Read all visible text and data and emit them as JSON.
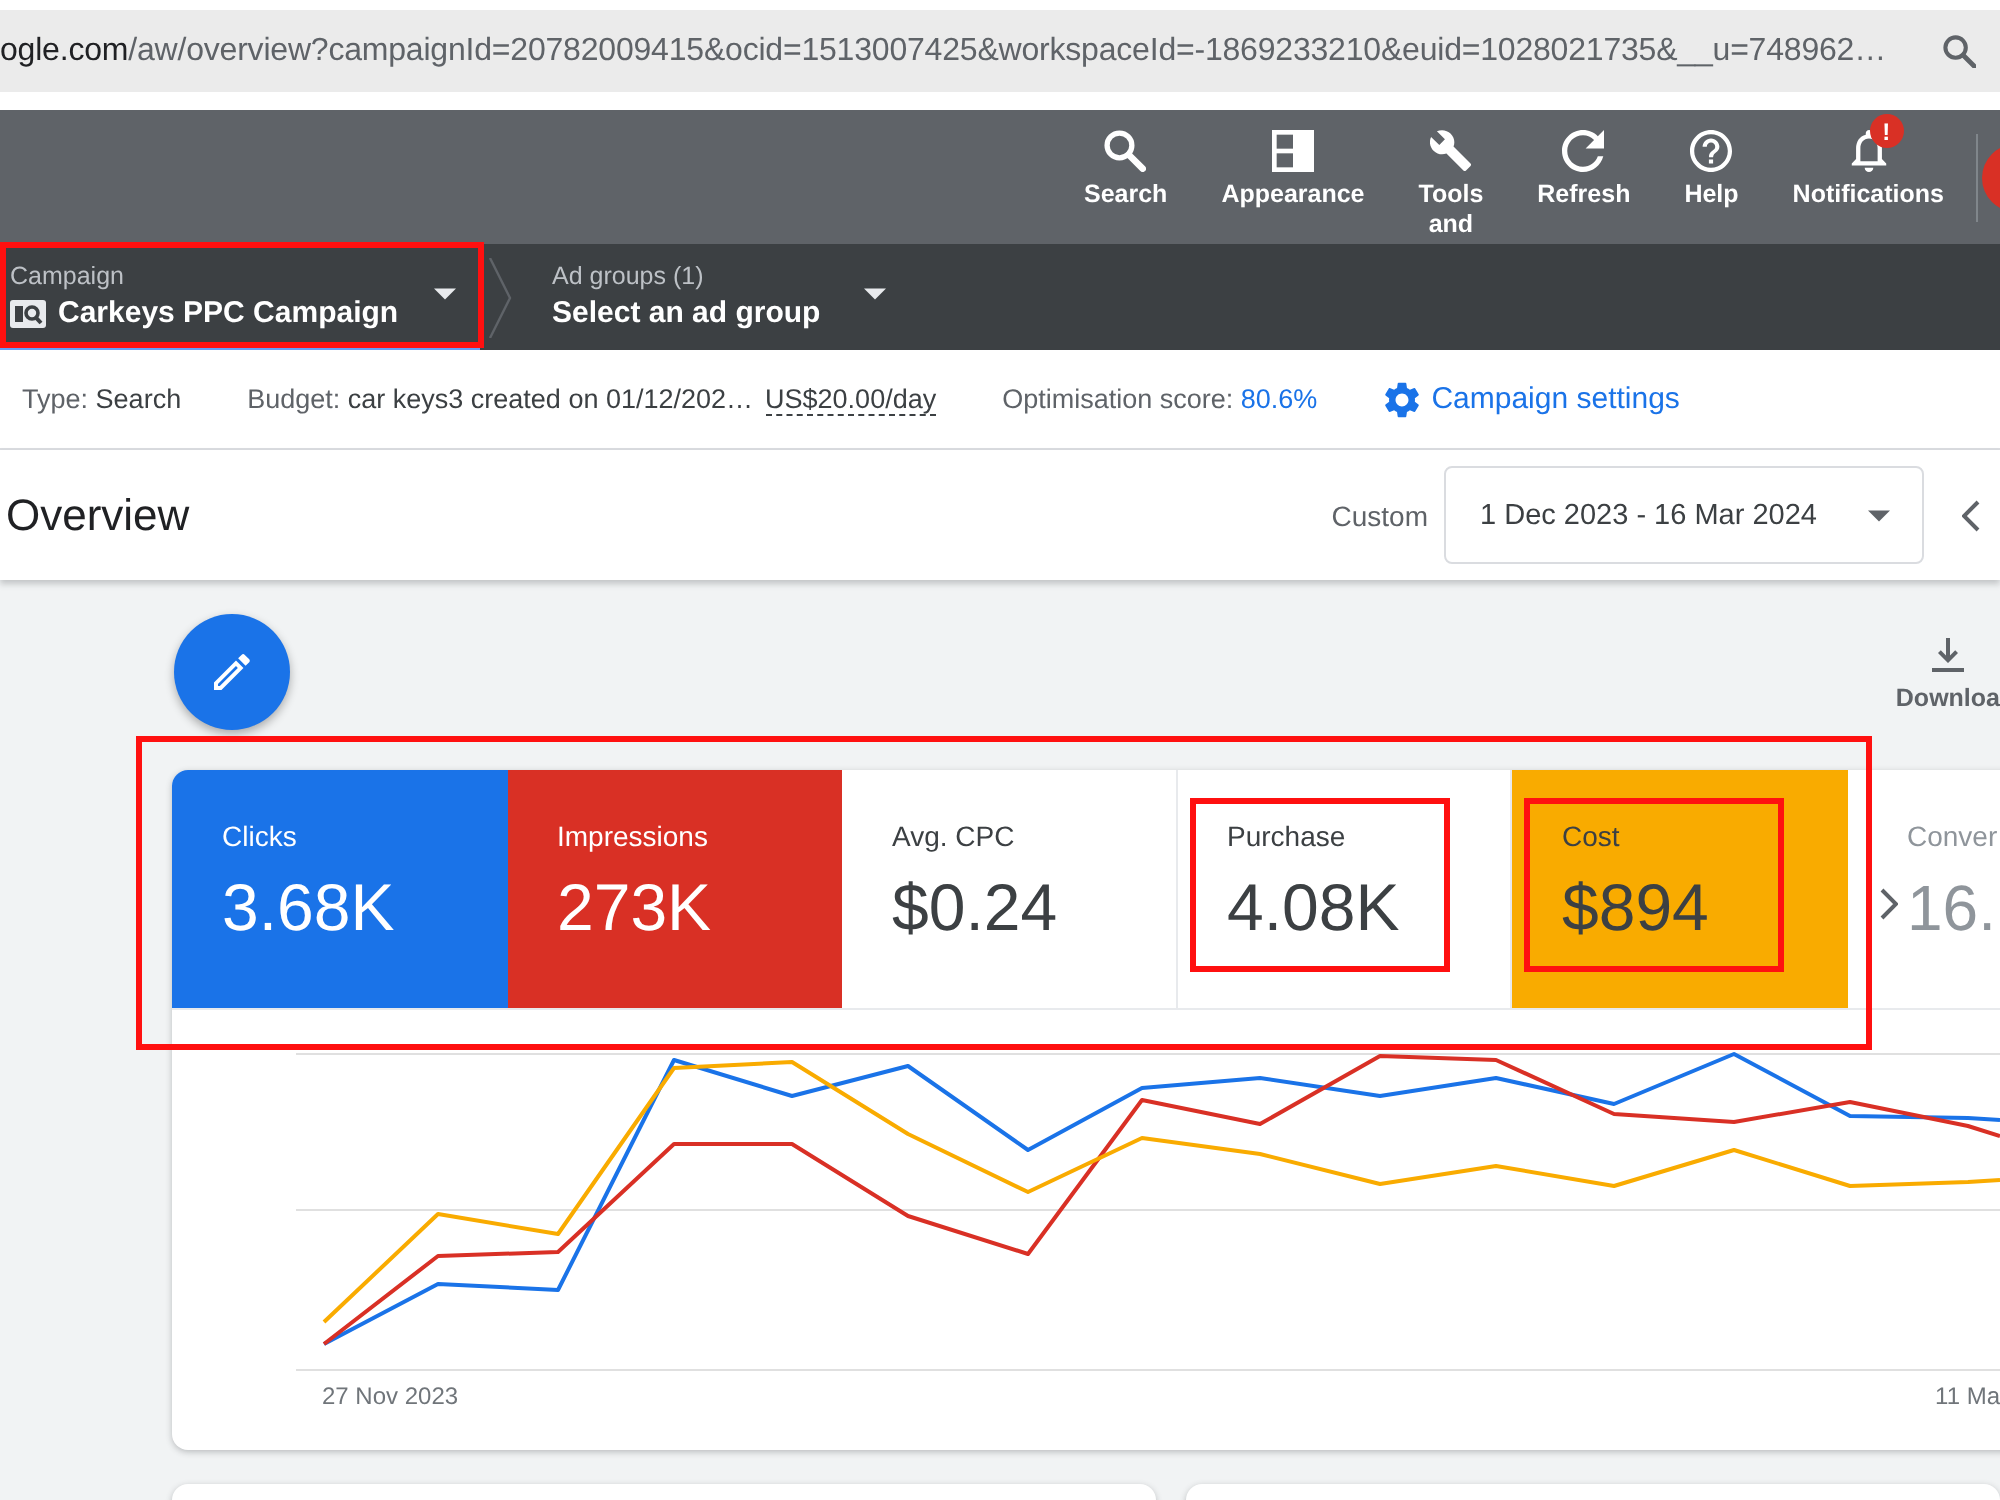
{
  "browser": {
    "url_host": "ogle.com",
    "url_path": "/aw/overview?campaignId=20782009415&ocid=1513007425&workspaceId=-1869233210&euid=1028021735&__u=748962…"
  },
  "toolbar": [
    {
      "kind": "search",
      "label": "Search"
    },
    {
      "kind": "appearance",
      "label": "Appearance"
    },
    {
      "kind": "tools",
      "label": "Tools and"
    },
    {
      "kind": "refresh",
      "label": "Refresh"
    },
    {
      "kind": "help",
      "label": "Help"
    },
    {
      "kind": "notifications",
      "label": "Notifications",
      "badge": "!"
    }
  ],
  "breadcrumbs": [
    {
      "kind": "campaign",
      "label": "Campaign",
      "value": "Carkeys PPC Campaign",
      "selected": true,
      "highlighted": true
    },
    {
      "kind": "ad_group",
      "label": "Ad groups (1)",
      "value": "Select an ad group",
      "selected": false,
      "highlighted": false
    }
  ],
  "info_bar": {
    "type": {
      "label": "Type:",
      "value": "Search"
    },
    "budget": {
      "label": "Budget:",
      "value": "car keys3 created on 01/12/202…",
      "amount": "US$20.00/day"
    },
    "optimisation": {
      "label": "Optimisation score:",
      "value": "80.6%"
    },
    "settings_link": "Campaign settings"
  },
  "overview": {
    "title": "Overview",
    "range_label": "Custom",
    "date_range": "1 Dec 2023 - 16 Mar 2024"
  },
  "download": {
    "label": "Downloa"
  },
  "metrics": {
    "highlighted": true,
    "tiles": [
      {
        "kind": "metric",
        "label": "Clicks",
        "value": "3.68K",
        "selected": true,
        "color": "#1a73e8",
        "highlighted": false
      },
      {
        "kind": "metric",
        "label": "Impressions",
        "value": "273K",
        "selected": true,
        "color": "#d93025",
        "highlighted": false
      },
      {
        "kind": "metric",
        "label": "Avg. CPC",
        "value": "$0.24",
        "selected": false,
        "highlighted": false
      },
      {
        "kind": "metric",
        "label": "Purchase",
        "value": "4.08K",
        "selected": false,
        "highlighted": true
      },
      {
        "kind": "metric",
        "label": "Cost",
        "value": "$894",
        "selected": true,
        "color": "#f9ab00",
        "highlighted": true
      },
      {
        "kind": "overflow",
        "label": "Conver",
        "value": "16."
      }
    ]
  },
  "chart": {
    "x_start": "27 Nov 2023",
    "x_end": "11 Ma"
  }
}
